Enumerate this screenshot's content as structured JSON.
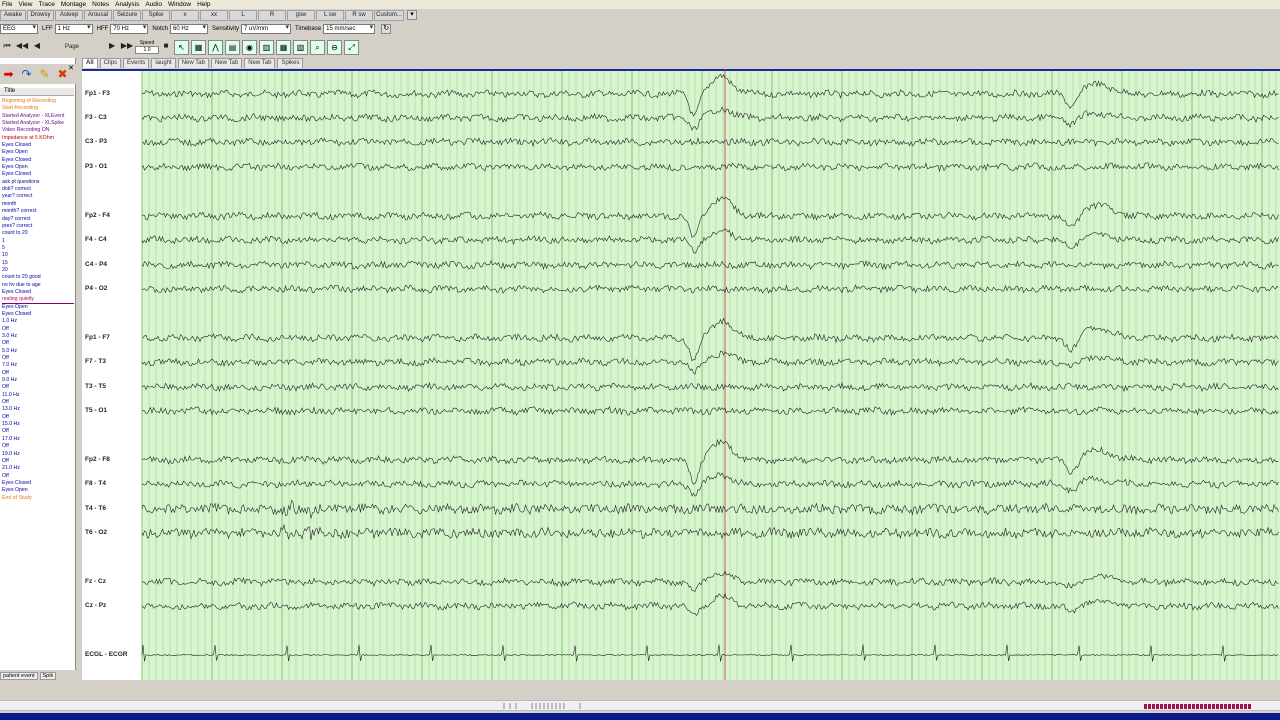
{
  "menu": [
    "File",
    "View",
    "Trace",
    "Montage",
    "Notes",
    "Analysis",
    "Audio",
    "Window",
    "Help"
  ],
  "quick_buttons": [
    "Awake",
    "Drowsy",
    "Asleep",
    "Arousal",
    "Seizure",
    "Spike",
    "x",
    "xx",
    "L",
    "R",
    "gsw",
    "L sw",
    "R sw",
    "Custom..."
  ],
  "controls": {
    "mode": "EEG",
    "lff_label": "LFF",
    "lff": "1 Hz",
    "hff_label": "HFF",
    "hff": "70 Hz",
    "notch_label": "Notch",
    "notch": "60 Hz",
    "sensitivity_label": "Sensitivity",
    "sensitivity": "7 uV/mm",
    "timebase_label": "Timebase",
    "timebase": "15 mm/sec"
  },
  "nav": {
    "page_label": "Page",
    "speed_label": "Speed",
    "speed_value": "1.0"
  },
  "tabs": [
    "All",
    "Clips",
    "Events",
    "laught",
    "New Tab",
    "New Tab",
    "New Tab",
    "Spikes"
  ],
  "event_panel": {
    "title_header": "Title",
    "bottom_left": "patient event",
    "bottom_right": "Spik",
    "events": [
      {
        "text": "Beginning of Recording",
        "color": "orange"
      },
      {
        "text": "Start Recording",
        "color": "orange"
      },
      {
        "text": "Started Analyzer - XLEvent",
        "color": "purple"
      },
      {
        "text": "Started Analyzer - XLSpike",
        "color": "purple"
      },
      {
        "text": "Video Recording ON",
        "color": "purple"
      },
      {
        "text": "Impedance at 5 KOhm",
        "color": "red"
      },
      {
        "text": "Eyes Closed",
        "color": "blue"
      },
      {
        "text": "Eyes Open",
        "color": "blue"
      },
      {
        "text": "Eyes Closed",
        "color": "blue"
      },
      {
        "text": "Eyes Open",
        "color": "blue"
      },
      {
        "text": "Eyes Closed",
        "color": "blue"
      },
      {
        "text": "ask pt questions",
        "color": "blue"
      },
      {
        "text": "dob? correct",
        "color": "blue"
      },
      {
        "text": "year? correct",
        "color": "blue"
      },
      {
        "text": "month",
        "color": "blue"
      },
      {
        "text": "month? correct",
        "color": "blue"
      },
      {
        "text": "day? correct",
        "color": "blue"
      },
      {
        "text": "pres? correct",
        "color": "blue"
      },
      {
        "text": "count to 20",
        "color": "blue"
      },
      {
        "text": "1",
        "color": "blue"
      },
      {
        "text": "5",
        "color": "blue"
      },
      {
        "text": "10",
        "color": "blue"
      },
      {
        "text": "15",
        "color": "blue"
      },
      {
        "text": "20",
        "color": "blue"
      },
      {
        "text": "count to 20 good",
        "color": "blue"
      },
      {
        "text": "no hv due to age",
        "color": "blue"
      },
      {
        "text": "Eyes Closed",
        "color": "blue"
      },
      {
        "text": "resting quietly",
        "color": "magenta"
      },
      {
        "text": "Eyes Open",
        "color": "blue"
      },
      {
        "text": "Eyes Closed",
        "color": "blue"
      },
      {
        "text": "1.0 Hz",
        "color": "blue"
      },
      {
        "text": "Off",
        "color": "blue"
      },
      {
        "text": "3.0 Hz",
        "color": "blue"
      },
      {
        "text": "Off",
        "color": "blue"
      },
      {
        "text": "5.0 Hz",
        "color": "blue"
      },
      {
        "text": "Off",
        "color": "blue"
      },
      {
        "text": "7.0 Hz",
        "color": "blue"
      },
      {
        "text": "Off",
        "color": "blue"
      },
      {
        "text": "9.0 Hz",
        "color": "blue"
      },
      {
        "text": "Off",
        "color": "blue"
      },
      {
        "text": "11.0 Hz",
        "color": "blue"
      },
      {
        "text": "Off",
        "color": "blue"
      },
      {
        "text": "13.0 Hz",
        "color": "blue"
      },
      {
        "text": "Off",
        "color": "blue"
      },
      {
        "text": "15.0 Hz",
        "color": "blue"
      },
      {
        "text": "Off",
        "color": "blue"
      },
      {
        "text": "17.0 Hz",
        "color": "blue"
      },
      {
        "text": "Off",
        "color": "blue"
      },
      {
        "text": "19.0 Hz",
        "color": "blue"
      },
      {
        "text": "Off",
        "color": "blue"
      },
      {
        "text": "21.0 Hz",
        "color": "blue"
      },
      {
        "text": "Off",
        "color": "blue"
      },
      {
        "text": "Eyes Closed",
        "color": "blue"
      },
      {
        "text": "Eyes Open",
        "color": "blue"
      },
      {
        "text": "End of Study",
        "color": "orange"
      }
    ]
  },
  "channels": [
    "Fp1 - F3",
    "F3 - C3",
    "C3 - P3",
    "P3 - O1",
    "Fp2 - F4",
    "F4 - C4",
    "C4 - P4",
    "P4 - O2",
    "Fp1 - F7",
    "F7 - T3",
    "T3 - T5",
    "T5 - O1",
    "Fp2 - F8",
    "F8 - T4",
    "T4 - T6",
    "T6 - O2",
    "Fz - Cz",
    "Cz - Pz",
    "ECGL - ECGR"
  ],
  "colors": {
    "grid_bg": "#d9f5d0",
    "grid_line": "#7fc46b",
    "trace": "#222222",
    "marker": "#cc3333",
    "statusbar": "#0a1a8a"
  }
}
